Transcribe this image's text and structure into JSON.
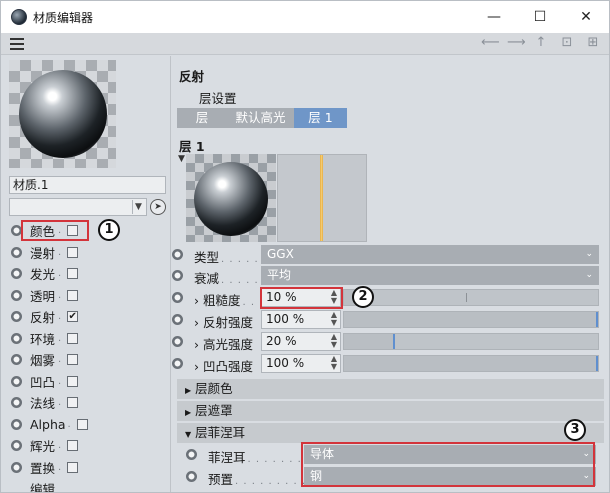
{
  "window": {
    "title": "材质编辑器",
    "minimize": "—",
    "maximize": "☐",
    "close": "✕"
  },
  "toolbar": {
    "back": "⟵",
    "forward": "⟶",
    "up": "↑",
    "lock": "⊡",
    "new": "⊞"
  },
  "material": {
    "name": "材质.1"
  },
  "channels": [
    {
      "label": "颜色",
      "checked": false
    },
    {
      "label": "漫射",
      "checked": false
    },
    {
      "label": "发光",
      "checked": false
    },
    {
      "label": "透明",
      "checked": false
    },
    {
      "label": "反射",
      "checked": true
    },
    {
      "label": "环境",
      "checked": false
    },
    {
      "label": "烟雾",
      "checked": false
    },
    {
      "label": "凹凸",
      "checked": false
    },
    {
      "label": "法线",
      "checked": false
    },
    {
      "label": "Alpha",
      "checked": false
    },
    {
      "label": "辉光",
      "checked": false
    },
    {
      "label": "置换",
      "checked": false
    },
    {
      "label": "编辑",
      "checked": null
    }
  ],
  "reflection": {
    "title": "反射",
    "layer_settings": "层设置",
    "tabs": [
      "层",
      "默认高光",
      "层 1"
    ],
    "active_tab": 2,
    "layer_title": "层 1",
    "type_label": "类型",
    "type_value": "GGX",
    "attenuation_label": "衰减",
    "attenuation_value": "平均",
    "roughness_label": "粗糙度",
    "roughness_value": "10 %",
    "roughness": 10,
    "reflect_strength_label": "反射强度",
    "reflect_strength_value": "100 %",
    "reflect_strength": 100,
    "specular_strength_label": "高光强度",
    "specular_strength_value": "20 %",
    "specular_strength": 20,
    "bump_strength_label": "凹凸强度",
    "bump_strength_value": "100 %",
    "bump_strength": 100,
    "group_color": "层颜色",
    "group_mask": "层遮罩",
    "group_fresnel": "层菲涅耳",
    "fresnel_label": "菲涅耳",
    "fresnel_value": "导体",
    "preset_label": "预置",
    "preset_value": "钢"
  },
  "annotations": [
    "1",
    "2",
    "3"
  ],
  "colors": {
    "highlight": "#d3343b",
    "active_tab": "#6f96c8",
    "combo_bg": "#a8adb3"
  }
}
